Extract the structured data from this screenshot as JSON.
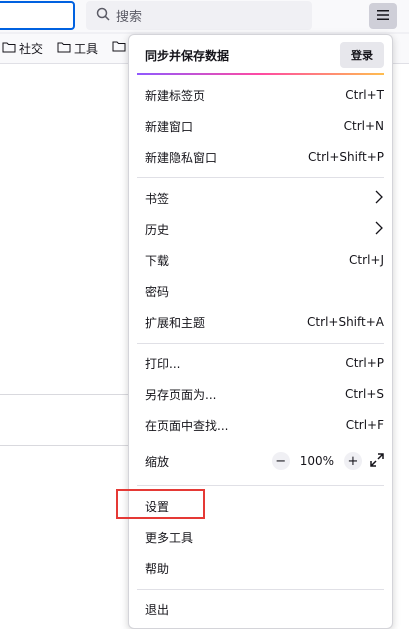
{
  "search": {
    "placeholder": "搜索"
  },
  "bookmarks": [
    {
      "label": "社交"
    },
    {
      "label": "工具"
    }
  ],
  "sync": {
    "title": "同步并保存数据",
    "login": "登录"
  },
  "menu": {
    "new_tab": {
      "label": "新建标签页",
      "accel": "Ctrl+T"
    },
    "new_window": {
      "label": "新建窗口",
      "accel": "Ctrl+N"
    },
    "new_private": {
      "label": "新建隐私窗口",
      "accel": "Ctrl+Shift+P"
    },
    "bookmarks": {
      "label": "书签"
    },
    "history": {
      "label": "历史"
    },
    "downloads": {
      "label": "下载",
      "accel": "Ctrl+J"
    },
    "passwords": {
      "label": "密码"
    },
    "addons": {
      "label": "扩展和主题",
      "accel": "Ctrl+Shift+A"
    },
    "print": {
      "label": "打印...",
      "accel": "Ctrl+P"
    },
    "save_as": {
      "label": "另存页面为...",
      "accel": "Ctrl+S"
    },
    "find": {
      "label": "在页面中查找...",
      "accel": "Ctrl+F"
    },
    "zoom": {
      "label": "缩放",
      "value": "100%",
      "minus": "−",
      "plus": "+"
    },
    "settings": {
      "label": "设置"
    },
    "more_tools": {
      "label": "更多工具"
    },
    "help": {
      "label": "帮助"
    },
    "quit": {
      "label": "退出"
    }
  },
  "colors": {
    "accent": "#0061e0",
    "highlight": "#e53935"
  }
}
